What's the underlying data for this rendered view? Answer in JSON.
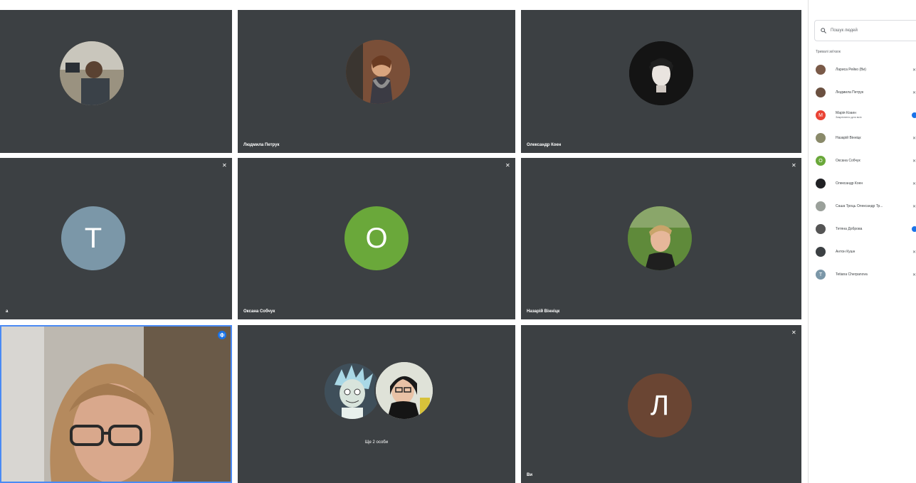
{
  "colors": {
    "tile_bg": "#3c4043",
    "accent": "#1a73e8",
    "avatar_t": "#7b97a8",
    "avatar_o": "#6aa83a",
    "avatar_l": "#6a4533"
  },
  "tiles": [
    {
      "name": ""
    },
    {
      "name": "Людмила Петрук"
    },
    {
      "name": "Олександр Коен"
    },
    {
      "name": "а",
      "initial": "Т"
    },
    {
      "name": "Оксана Собчук",
      "initial": "О"
    },
    {
      "name": "Назарій Вінніцк"
    },
    {
      "name": ""
    },
    {
      "name": "Ще 2 особи"
    },
    {
      "name": "Ви",
      "initial": "Л"
    }
  ],
  "panel": {
    "search_placeholder": "Пошук людей",
    "section_title": "Тривалі зв'язок",
    "participants": [
      {
        "name": "Лариса Рейко (Ви)",
        "avatar_color": "#7a5a48",
        "mic": "off"
      },
      {
        "name": "Людмила Петрук",
        "avatar_color": "#6b5040",
        "mic": "off"
      },
      {
        "name": "Марія Коаен",
        "sub": "Закріплено для всіх",
        "avatar_color": "#ea4335",
        "initial": "М",
        "mic": "on"
      },
      {
        "name": "Назарій Вінніцк",
        "avatar_color": "#8a8a6a",
        "mic": "off"
      },
      {
        "name": "Оксана Собчук",
        "avatar_color": "#6aa83a",
        "initial": "О",
        "mic": "off"
      },
      {
        "name": "Олександр Коен",
        "avatar_color": "#202124",
        "mic": "off"
      },
      {
        "name": "Саша Троць Олександр Тр...",
        "avatar_color": "#9aa09a",
        "mic": "off"
      },
      {
        "name": "Тетяна Доброва",
        "avatar_color": "#555555",
        "mic": "on"
      },
      {
        "name": "Антон Кушн",
        "avatar_color": "#3c4043",
        "mic": "off"
      },
      {
        "name": "Tetiana Cherpanova",
        "avatar_color": "#7b97a8",
        "initial": "T",
        "mic": "off"
      }
    ]
  }
}
